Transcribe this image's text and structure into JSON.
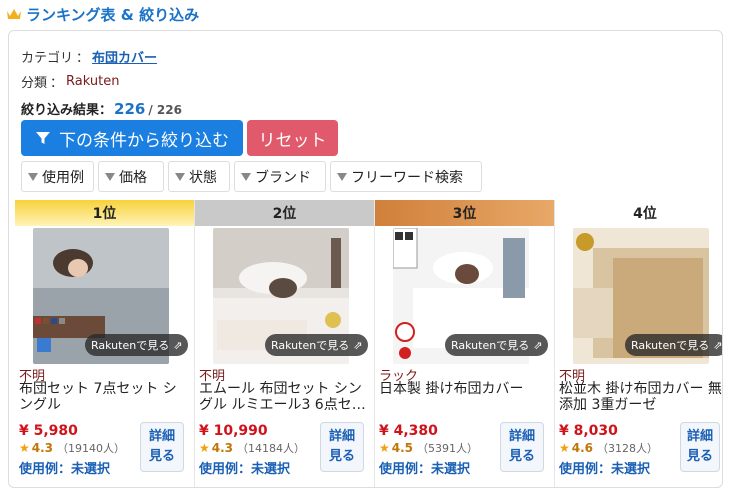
{
  "header": {
    "title": "ランキング表 & 絞り込み",
    "crown_color": "#f2b01e"
  },
  "filters": {
    "category_label": "カテゴリ",
    "category_value": "布団カバー",
    "brand_label": "分類",
    "brand_value": "Rakuten",
    "results_label": "絞り込み結果：",
    "results_count": "226",
    "results_total": "/ 226",
    "filter_button": "下の条件から絞り込む",
    "reset_button": "リセット",
    "tags": [
      "使用例",
      "価格",
      "状態",
      "ブランド",
      "フリーワード検索"
    ]
  },
  "ranking": [
    {
      "rank": "1位",
      "rank_color": "#f7d23a",
      "brand": "不明",
      "name": "布団セット 7点セット シングル",
      "price": "¥ 5,980",
      "score": "4.3",
      "reviews": "（19140人）",
      "usage": "使用例：未選択",
      "chip": "Rakutenで見る",
      "detail_top": "詳細",
      "detail_bottom": "見る"
    },
    {
      "rank": "2位",
      "rank_color": "#c9c9c9",
      "brand": "不明",
      "name": "エムール 布団セット シングル ルミエール3 6点セ…",
      "price": "¥ 10,990",
      "score": "4.3",
      "reviews": "（14184人）",
      "usage": "使用例：未選択",
      "chip": "Rakutenで見る",
      "detail_top": "詳細",
      "detail_bottom": "見る"
    },
    {
      "rank": "3位",
      "rank_color": "#d9914a",
      "brand": "ラック",
      "name": "日本製 掛け布団カバー",
      "price": "¥ 4,380",
      "score": "4.5",
      "reviews": "（5391人）",
      "usage": "使用例：未選択",
      "chip": "Rakutenで見る",
      "detail_top": "詳細",
      "detail_bottom": "見る"
    },
    {
      "rank": "4位",
      "rank_color": "#ffffff",
      "brand": "不明",
      "name": "松並木 掛け布団カバー 無添加 3重ガーゼ",
      "price": "¥ 8,030",
      "score": "4.6",
      "reviews": "（3128人）",
      "usage": "使用例：未選択",
      "chip": "Rakutenで見る",
      "detail_top": "詳細",
      "detail_bottom": "見る"
    }
  ]
}
